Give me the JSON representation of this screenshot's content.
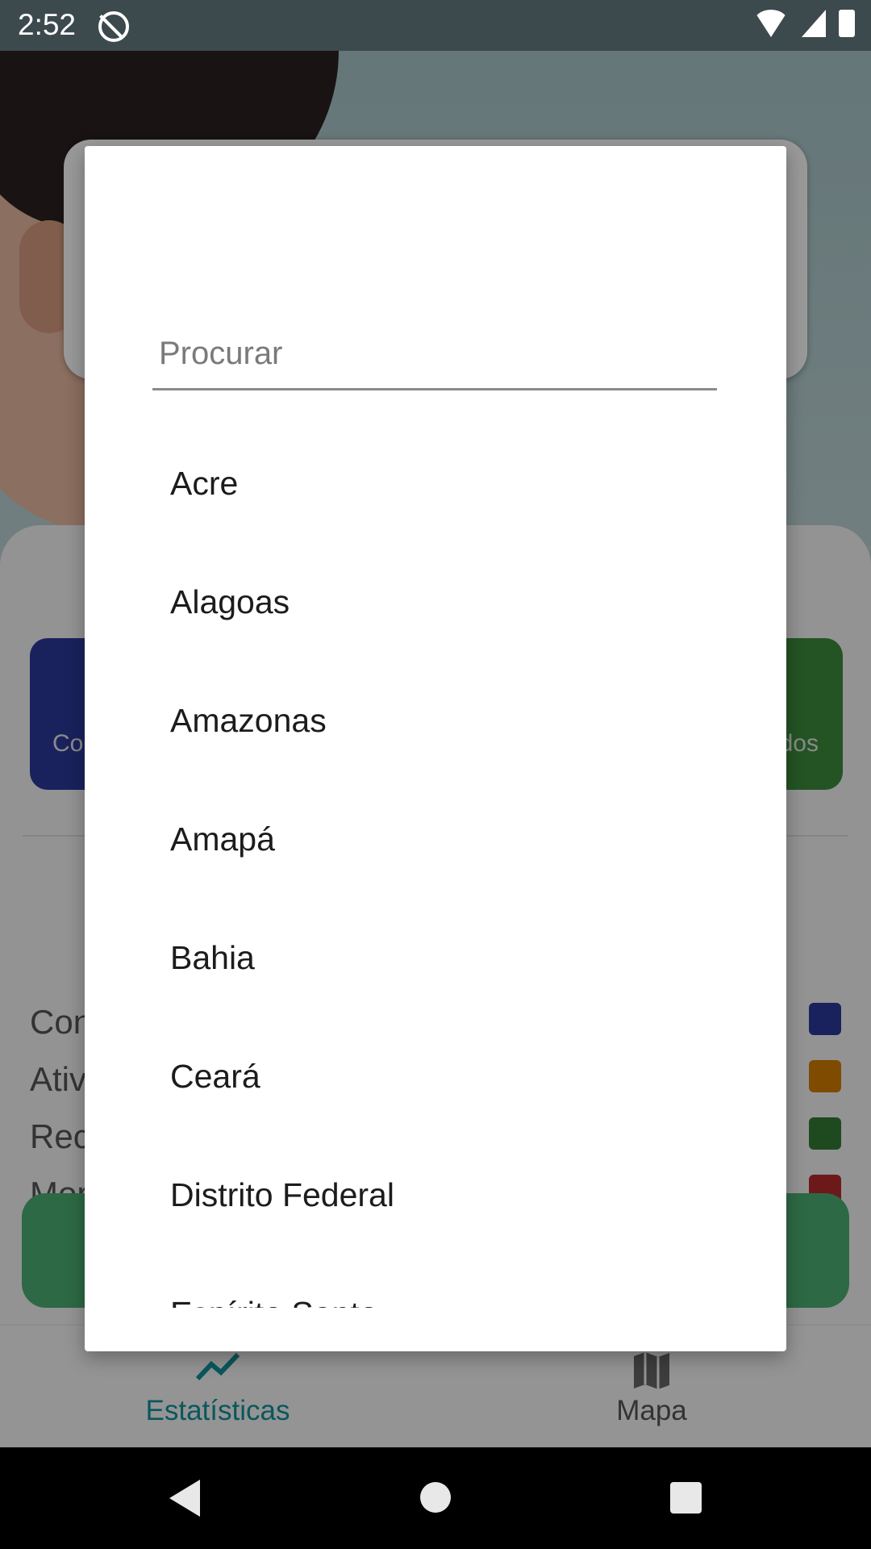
{
  "status_bar": {
    "time": "2:52"
  },
  "background": {
    "card_left_label": "Co",
    "card_right_label": "dos",
    "legend": [
      {
        "label": "Con",
        "color": "#2c3a9c"
      },
      {
        "label": "Ativ",
        "color": "#d47d00"
      },
      {
        "label": "Rec",
        "color": "#347a34"
      },
      {
        "label": "Mor",
        "color": "#b82b2b"
      }
    ]
  },
  "bottom_nav": [
    {
      "label": "Estatísticas",
      "icon": "trending-up-icon",
      "active": true
    },
    {
      "label": "Mapa",
      "icon": "map-icon",
      "active": false
    }
  ],
  "dialog": {
    "search": {
      "placeholder": "Procurar",
      "value": ""
    },
    "items": [
      "Acre",
      "Alagoas",
      "Amazonas",
      "Amapá",
      "Bahia",
      "Ceará",
      "Distrito Federal",
      "Espírito Santo"
    ]
  }
}
